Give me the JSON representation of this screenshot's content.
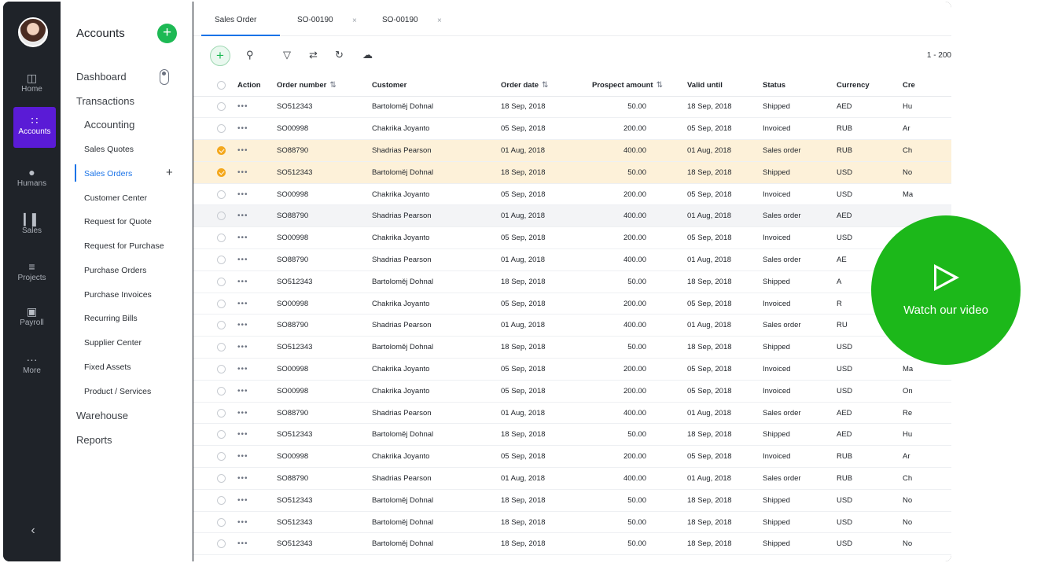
{
  "rail": {
    "items": [
      {
        "label": "Home",
        "icon": "home-icon"
      },
      {
        "label": "Accounts",
        "icon": "grid-icon",
        "active": true
      },
      {
        "label": "Humans",
        "icon": "user-icon"
      },
      {
        "label": "Sales",
        "icon": "bar-chart-icon"
      },
      {
        "label": "Projects",
        "icon": "list-icon"
      },
      {
        "label": "Payroll",
        "icon": "wallet-icon"
      },
      {
        "label": "More",
        "icon": "more-icon"
      }
    ],
    "collapse_icon": "chevron-left-icon"
  },
  "sidebar": {
    "title": "Accounts",
    "dashboard": "Dashboard",
    "transactions": "Transactions",
    "accounting": "Accounting",
    "items": [
      "Sales Quotes",
      "Sales Orders",
      "Customer Center",
      "Request for Quote",
      "Request for Purchase",
      "Purchase Orders",
      "Purchase Invoices",
      "Recurring Bills",
      "Supplier Center",
      "Fixed Assets",
      "Product / Services"
    ],
    "active_item": "Sales Orders",
    "warehouse": "Warehouse",
    "reports": "Reports"
  },
  "tabs": [
    {
      "label": "Sales Order",
      "closable": false,
      "active": true
    },
    {
      "label": "SO-00190",
      "closable": true
    },
    {
      "label": "SO-00190",
      "closable": true
    }
  ],
  "toolbar": {
    "paging": "1 - 200"
  },
  "table": {
    "columns": [
      "",
      "Action",
      "Order number",
      "Customer",
      "Order date",
      "Prospect amount",
      "Valid until",
      "Status",
      "Currency",
      "Cre"
    ],
    "rows": [
      {
        "order": "SO512343",
        "customer": "Bartoloměj Dohnal",
        "date": "18 Sep, 2018",
        "amount": "50.00",
        "valid": "18 Sep, 2018",
        "status": "Shipped",
        "currency": "AED",
        "cre": "Hu",
        "state": ""
      },
      {
        "order": "SO00998",
        "customer": "Chakrika Joyanto",
        "date": "05 Sep, 2018",
        "amount": "200.00",
        "valid": "05 Sep, 2018",
        "status": "Invoiced",
        "currency": "RUB",
        "cre": "Ar",
        "state": ""
      },
      {
        "order": "SO88790",
        "customer": "Shadrias Pearson",
        "date": "01 Aug, 2018",
        "amount": "400.00",
        "valid": "01 Aug, 2018",
        "status": "Sales order",
        "currency": "RUB",
        "cre": "Ch",
        "state": "selected"
      },
      {
        "order": "SO512343",
        "customer": "Bartoloměj Dohnal",
        "date": "18 Sep, 2018",
        "amount": "50.00",
        "valid": "18 Sep, 2018",
        "status": "Shipped",
        "currency": "USD",
        "cre": "No",
        "state": "selected"
      },
      {
        "order": "SO00998",
        "customer": "Chakrika Joyanto",
        "date": "05 Sep, 2018",
        "amount": "200.00",
        "valid": "05 Sep, 2018",
        "status": "Invoiced",
        "currency": "USD",
        "cre": "Ma",
        "state": ""
      },
      {
        "order": "SO88790",
        "customer": "Shadrias Pearson",
        "date": "01 Aug, 2018",
        "amount": "400.00",
        "valid": "01 Aug, 2018",
        "status": "Sales order",
        "currency": "AED",
        "cre": "",
        "state": "hover"
      },
      {
        "order": "SO00998",
        "customer": "Chakrika Joyanto",
        "date": "05 Sep, 2018",
        "amount": "200.00",
        "valid": "05 Sep, 2018",
        "status": "Invoiced",
        "currency": "USD",
        "cre": "",
        "state": ""
      },
      {
        "order": "SO88790",
        "customer": "Shadrias Pearson",
        "date": "01 Aug, 2018",
        "amount": "400.00",
        "valid": "01 Aug, 2018",
        "status": "Sales order",
        "currency": "AE",
        "cre": "",
        "state": ""
      },
      {
        "order": "SO512343",
        "customer": "Bartoloměj Dohnal",
        "date": "18 Sep, 2018",
        "amount": "50.00",
        "valid": "18 Sep, 2018",
        "status": "Shipped",
        "currency": "A",
        "cre": "",
        "state": ""
      },
      {
        "order": "SO00998",
        "customer": "Chakrika Joyanto",
        "date": "05 Sep, 2018",
        "amount": "200.00",
        "valid": "05 Sep, 2018",
        "status": "Invoiced",
        "currency": "R",
        "cre": "",
        "state": ""
      },
      {
        "order": "SO88790",
        "customer": "Shadrias Pearson",
        "date": "01 Aug, 2018",
        "amount": "400.00",
        "valid": "01 Aug, 2018",
        "status": "Sales order",
        "currency": "RU",
        "cre": "",
        "state": ""
      },
      {
        "order": "SO512343",
        "customer": "Bartoloměj Dohnal",
        "date": "18 Sep, 2018",
        "amount": "50.00",
        "valid": "18 Sep, 2018",
        "status": "Shipped",
        "currency": "USD",
        "cre": "",
        "state": ""
      },
      {
        "order": "SO00998",
        "customer": "Chakrika Joyanto",
        "date": "05 Sep, 2018",
        "amount": "200.00",
        "valid": "05 Sep, 2018",
        "status": "Invoiced",
        "currency": "USD",
        "cre": "Ma",
        "state": ""
      },
      {
        "order": "SO00998",
        "customer": "Chakrika Joyanto",
        "date": "05 Sep, 2018",
        "amount": "200.00",
        "valid": "05 Sep, 2018",
        "status": "Invoiced",
        "currency": "USD",
        "cre": "On",
        "state": ""
      },
      {
        "order": "SO88790",
        "customer": "Shadrias Pearson",
        "date": "01 Aug, 2018",
        "amount": "400.00",
        "valid": "01 Aug, 2018",
        "status": "Sales order",
        "currency": "AED",
        "cre": "Re",
        "state": ""
      },
      {
        "order": "SO512343",
        "customer": "Bartoloměj Dohnal",
        "date": "18 Sep, 2018",
        "amount": "50.00",
        "valid": "18 Sep, 2018",
        "status": "Shipped",
        "currency": "AED",
        "cre": "Hu",
        "state": ""
      },
      {
        "order": "SO00998",
        "customer": "Chakrika Joyanto",
        "date": "05 Sep, 2018",
        "amount": "200.00",
        "valid": "05 Sep, 2018",
        "status": "Invoiced",
        "currency": "RUB",
        "cre": "Ar",
        "state": ""
      },
      {
        "order": "SO88790",
        "customer": "Shadrias Pearson",
        "date": "01 Aug, 2018",
        "amount": "400.00",
        "valid": "01 Aug, 2018",
        "status": "Sales order",
        "currency": "RUB",
        "cre": "Ch",
        "state": ""
      },
      {
        "order": "SO512343",
        "customer": "Bartoloměj Dohnal",
        "date": "18 Sep, 2018",
        "amount": "50.00",
        "valid": "18 Sep, 2018",
        "status": "Shipped",
        "currency": "USD",
        "cre": "No",
        "state": ""
      },
      {
        "order": "SO512343",
        "customer": "Bartoloměj Dohnal",
        "date": "18 Sep, 2018",
        "amount": "50.00",
        "valid": "18 Sep, 2018",
        "status": "Shipped",
        "currency": "USD",
        "cre": "No",
        "state": ""
      },
      {
        "order": "SO512343",
        "customer": "Bartoloměj Dohnal",
        "date": "18 Sep, 2018",
        "amount": "50.00",
        "valid": "18 Sep, 2018",
        "status": "Shipped",
        "currency": "USD",
        "cre": "No",
        "state": ""
      }
    ]
  },
  "video": {
    "label": "Watch our video"
  },
  "colors": {
    "accent": "#5a1bd6",
    "link": "#1a73e8",
    "add": "#1db954",
    "selected_row": "#fdf1d9",
    "video": "#1cb81a"
  }
}
